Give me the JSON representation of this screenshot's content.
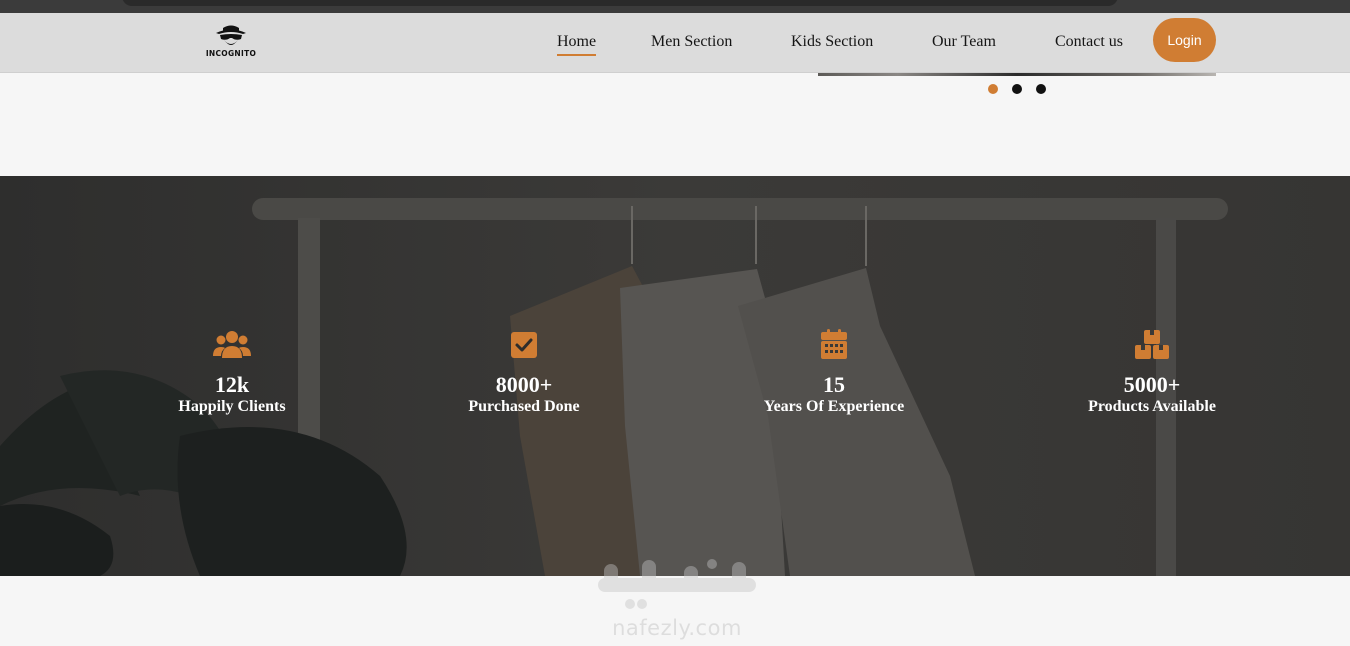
{
  "nav": {
    "logo_text": "INCOGNITO",
    "links": [
      "Home",
      "Men Section",
      "Kids Section",
      "Our Team",
      "Contact us"
    ],
    "login_label": "Login"
  },
  "carousel": {
    "slide_count": 3,
    "active_index": 0
  },
  "stats": [
    {
      "icon": "users-icon",
      "value": "12k",
      "label": "Happily Clients"
    },
    {
      "icon": "check-square-icon",
      "value": "8000+",
      "label": "Purchased Done"
    },
    {
      "icon": "calendar-icon",
      "value": "15",
      "label": "Years Of Experience"
    },
    {
      "icon": "boxes-icon",
      "value": "5000+",
      "label": "Products Available"
    }
  ],
  "watermark": {
    "arabic_text": "نفذلي",
    "latin_text": "nafezly.com"
  },
  "colors": {
    "accent": "#d07d33",
    "navbar_bg": "#dcdcdc",
    "page_bg": "#f6f6f6",
    "stats_overlay": "#333230"
  }
}
